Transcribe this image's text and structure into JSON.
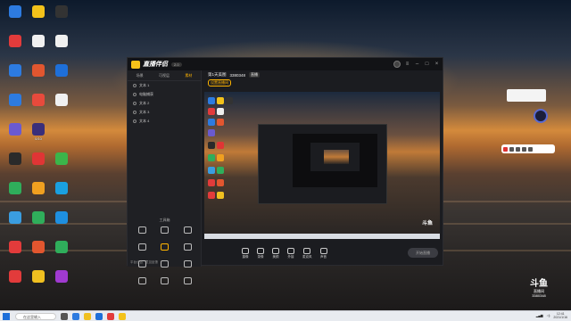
{
  "desktop": {
    "icons": [
      {
        "label": "",
        "color": "#2d7be0",
        "col": 0,
        "row": 0
      },
      {
        "label": "",
        "color": "#f3c21a",
        "col": 1,
        "row": 0
      },
      {
        "label": "",
        "color": "#333333",
        "col": 2,
        "row": 0
      },
      {
        "label": "",
        "color": "#e23b3b",
        "col": 0,
        "row": 1
      },
      {
        "label": "",
        "color": "#f0f0f0",
        "col": 1,
        "row": 1
      },
      {
        "label": "",
        "color": "#f0f0f0",
        "col": 2,
        "row": 1
      },
      {
        "label": "",
        "color": "#2d7be0",
        "col": 0,
        "row": 2
      },
      {
        "label": "",
        "color": "#e2562f",
        "col": 1,
        "row": 2
      },
      {
        "label": "",
        "color": "#1e6fd9",
        "col": 2,
        "row": 2
      },
      {
        "label": "",
        "color": "#2d7be0",
        "col": 0,
        "row": 3
      },
      {
        "label": "",
        "color": "#e84a3c",
        "col": 1,
        "row": 3
      },
      {
        "label": "",
        "color": "#f0f0f0",
        "col": 2,
        "row": 3
      },
      {
        "label": "",
        "color": "#6a5ad0",
        "col": 0,
        "row": 4
      },
      {
        "label": "0/10",
        "color": "#3a2e7a",
        "col": 1,
        "row": 4
      },
      {
        "label": "",
        "color": "#2a2a2a",
        "col": 0,
        "row": 5
      },
      {
        "label": "",
        "color": "#e03535",
        "col": 1,
        "row": 5
      },
      {
        "label": "",
        "color": "#3bb54a",
        "col": 2,
        "row": 5
      },
      {
        "label": "",
        "color": "#2fae5b",
        "col": 0,
        "row": 6
      },
      {
        "label": "",
        "color": "#f0a020",
        "col": 1,
        "row": 6
      },
      {
        "label": "",
        "color": "#1aa0e0",
        "col": 2,
        "row": 6
      },
      {
        "label": "",
        "color": "#3a9de0",
        "col": 0,
        "row": 7
      },
      {
        "label": "",
        "color": "#2fae5b",
        "col": 1,
        "row": 7
      },
      {
        "label": "",
        "color": "#1e8fe0",
        "col": 2,
        "row": 7
      },
      {
        "label": "",
        "color": "#e23b3b",
        "col": 0,
        "row": 8
      },
      {
        "label": "",
        "color": "#e2562f",
        "col": 1,
        "row": 8
      },
      {
        "label": "",
        "color": "#2fae5b",
        "col": 2,
        "row": 8
      },
      {
        "label": "",
        "color": "#e23b3b",
        "col": 0,
        "row": 9
      },
      {
        "label": "",
        "color": "#f0c020",
        "col": 1,
        "row": 9
      },
      {
        "label": "",
        "color": "#a03ad0",
        "col": 2,
        "row": 9
      }
    ]
  },
  "app": {
    "name": "直播伴侣",
    "version": "2.0",
    "tabs": [
      "场景",
      "可视层",
      "素材"
    ],
    "active_tab": 2,
    "scenes": [
      "文本 1",
      "电脑捕获",
      "文本 2",
      "文本 3",
      "文本 4"
    ],
    "tools_title": "工具箱",
    "bottom_links": [
      "平台公告",
      "意见反馈"
    ],
    "room": {
      "title": "第1天美图",
      "id": "3380348",
      "tag": "直播"
    },
    "room2": {
      "pill": "设置直播间"
    },
    "controls": [
      "摄像",
      "录像",
      "美颜",
      "外接",
      "麦克风",
      "声音"
    ],
    "start_label": "开始直播"
  },
  "desktop_badge": {
    "brand": "斗鱼",
    "line1": "直播间",
    "line2": "3380348"
  },
  "taskbar": {
    "search": "在这里输入",
    "time": "12:41",
    "date": "2021/1/16"
  },
  "colors": {
    "accent": "#ffb400",
    "window_bg": "#1b1c20"
  }
}
